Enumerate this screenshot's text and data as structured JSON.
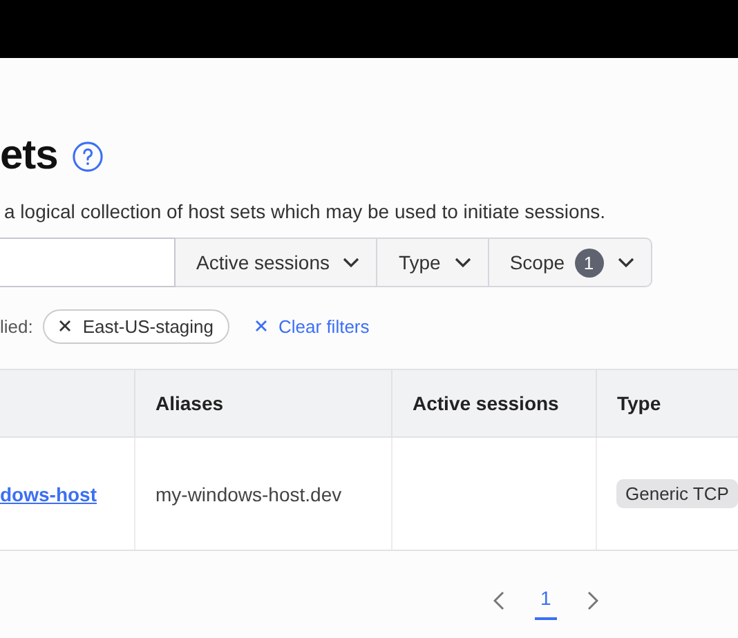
{
  "page": {
    "title": "ets",
    "description": "a logical collection of host sets which may be used to initiate sessions."
  },
  "filters": [
    {
      "label": "Active sessions"
    },
    {
      "label": "Type"
    },
    {
      "label": "Scope",
      "count": "1"
    }
  ],
  "applied": {
    "label": "lied:",
    "chips": [
      "East-US-staging"
    ],
    "clear": "Clear filters"
  },
  "table": {
    "columns": [
      "",
      "Aliases",
      "Active sessions",
      "Type"
    ],
    "rows": [
      {
        "name": "dows-host",
        "alias": "my-windows-host.dev",
        "active_sessions": "",
        "type": "Generic TCP"
      }
    ]
  },
  "pagination": {
    "pages": [
      {
        "label": "1",
        "selected": true
      }
    ]
  }
}
